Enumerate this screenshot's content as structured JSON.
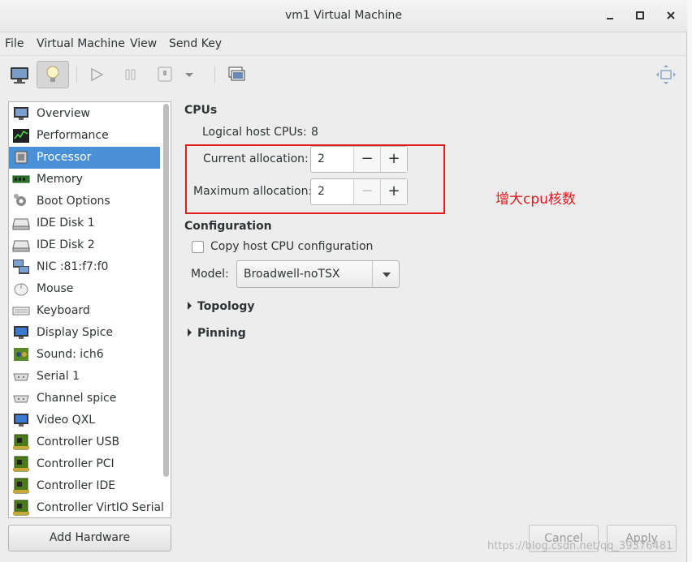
{
  "window": {
    "title": "vm1 Virtual Machine"
  },
  "menu": [
    "File",
    "Virtual Machine",
    "View",
    "Send Key"
  ],
  "sidebar": {
    "items": [
      {
        "label": "Overview",
        "icon": "monitor-icon"
      },
      {
        "label": "Performance",
        "icon": "performance-graph-icon"
      },
      {
        "label": "Processor",
        "icon": "processor-chip-icon"
      },
      {
        "label": "Memory",
        "icon": "memory-module-icon"
      },
      {
        "label": "Boot Options",
        "icon": "gear-icon"
      },
      {
        "label": "IDE Disk 1",
        "icon": "disk-drive-icon"
      },
      {
        "label": "IDE Disk 2",
        "icon": "disk-drive-icon"
      },
      {
        "label": "NIC :81:f7:f0",
        "icon": "network-icon"
      },
      {
        "label": "Mouse",
        "icon": "mouse-icon"
      },
      {
        "label": "Keyboard",
        "icon": "keyboard-icon"
      },
      {
        "label": "Display Spice",
        "icon": "display-icon"
      },
      {
        "label": "Sound: ich6",
        "icon": "sound-card-icon"
      },
      {
        "label": "Serial 1",
        "icon": "serial-port-icon"
      },
      {
        "label": "Channel spice",
        "icon": "serial-port-icon"
      },
      {
        "label": "Video QXL",
        "icon": "display-icon"
      },
      {
        "label": "Controller USB",
        "icon": "controller-card-icon"
      },
      {
        "label": "Controller PCI",
        "icon": "controller-card-icon"
      },
      {
        "label": "Controller IDE",
        "icon": "controller-card-icon"
      },
      {
        "label": "Controller VirtIO Serial",
        "icon": "controller-card-icon"
      }
    ],
    "selected_index": 2,
    "add_hardware": "Add Hardware"
  },
  "cpus": {
    "heading": "CPUs",
    "logical_label": "Logical host CPUs:",
    "logical_value": "8",
    "current_label": "Current allocation:",
    "current_value": "2",
    "max_label": "Maximum allocation:",
    "max_value": "2"
  },
  "annotation": {
    "text": "增大cpu核数",
    "color": "#e01c1c"
  },
  "configuration": {
    "heading": "Configuration",
    "copy_host_label": "Copy host CPU configuration",
    "copy_host_checked": false,
    "model_label": "Model:",
    "model_value": "Broadwell-noTSX"
  },
  "expanders": {
    "topology": "Topology",
    "pinning": "Pinning"
  },
  "buttons": {
    "cancel": "Cancel",
    "apply": "Apply"
  },
  "watermark": "https://blog.csdn.net/qq_39376481",
  "colors": {
    "selection": "#4a90d9",
    "annotation": "#e01c1c"
  }
}
